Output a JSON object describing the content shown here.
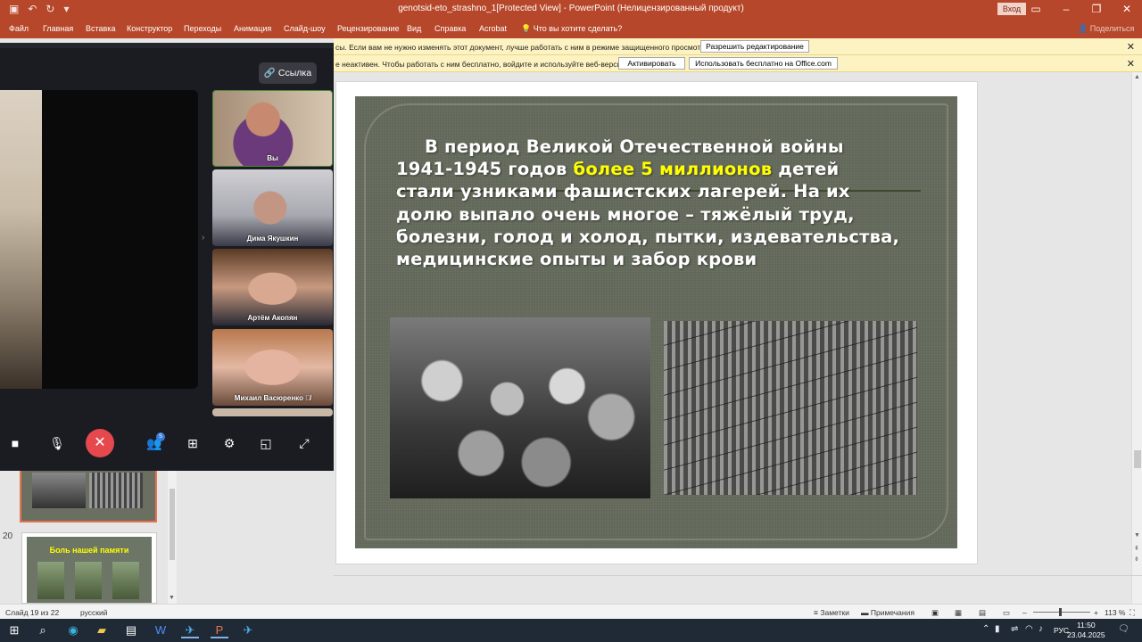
{
  "window": {
    "doc_title": "genotsid-eto_strashno_1[Protected View]  -  PowerPoint (Нелицензированный продукт)",
    "login_label": "Вход",
    "qat_icons": [
      "save-icon",
      "undo-icon",
      "redo-icon",
      "customize-icon"
    ],
    "controls": [
      "ribbon-options-icon",
      "minimize-icon",
      "restore-icon",
      "close-icon"
    ]
  },
  "ribbon": {
    "tabs": [
      "Файл",
      "Главная",
      "Вставка",
      "Конструктор",
      "Переходы",
      "Анимация",
      "Слайд-шоу",
      "Рецензирование",
      "Вид",
      "Справка",
      "Acrobat"
    ],
    "tell_me": "Что вы хотите сделать?",
    "share": "Поделиться"
  },
  "messages": [
    {
      "text": "сы. Если вам не нужно изменять этот документ, лучше работать с ним в режиме защищенного просмотра.",
      "buttons": [
        "Разрешить редактирование"
      ]
    },
    {
      "text": "е неактивен. Чтобы работать с ним бесплатно, войдите и используйте веб-версию.",
      "buttons": [
        "Активировать",
        "Использовать бесплатно на Office.com"
      ]
    }
  ],
  "slide": {
    "line1": "В период Великой Отечественной войны",
    "line2_pre": "1941-1945 годов ",
    "line2_highlight": "более 5 миллионов",
    "line2_post": " детей",
    "line3": "стали узниками фашистских лагерей. На их",
    "line4": "долю выпало очень многое – тяжёлый труд,",
    "line5": "болезни, голод и холод, пытки, издевательства,",
    "line6": "медицинские опыты и забор крови",
    "highlight_color": "#ffff00"
  },
  "thumbnails": {
    "slide20_number": "20",
    "slide20_title": "Боль нашей памяти"
  },
  "call": {
    "link_label": "Ссылка",
    "participants": [
      {
        "name": "Вы"
      },
      {
        "name": "Дима Якушкин"
      },
      {
        "name": "Артём Акопян"
      },
      {
        "name": "Михаил Васюренко"
      }
    ],
    "participants_count": "5",
    "accent_hangup": "#e5484d"
  },
  "status": {
    "slide_of": "Слайд 19 из 22",
    "language": "русский",
    "notes": "Заметки",
    "comments": "Примечания",
    "zoom": "113 %"
  },
  "taskbar": {
    "lang": "РУС",
    "time": "11:50",
    "date": "23.04.2025"
  }
}
